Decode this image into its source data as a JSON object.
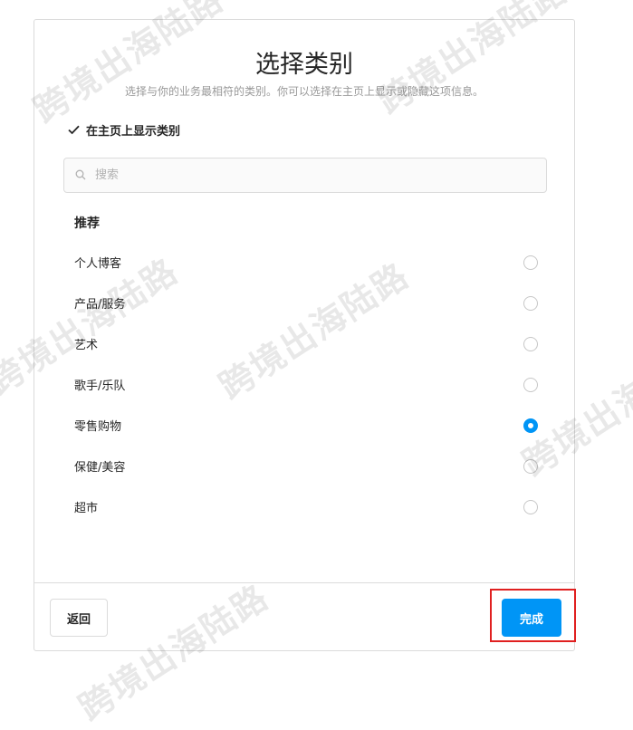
{
  "dialog": {
    "title": "选择类别",
    "subtitle": "选择与你的业务最相符的类别。你可以选择在主页上显示或隐藏这项信息。",
    "show_on_profile": {
      "label": "在主页上显示类别",
      "checked": true
    },
    "search": {
      "placeholder": "搜索",
      "value": ""
    },
    "section_title": "推荐",
    "categories": [
      {
        "label": "个人博客",
        "selected": false
      },
      {
        "label": "产品/服务",
        "selected": false
      },
      {
        "label": "艺术",
        "selected": false
      },
      {
        "label": "歌手/乐队",
        "selected": false
      },
      {
        "label": "零售购物",
        "selected": true
      },
      {
        "label": "保健/美容",
        "selected": false
      },
      {
        "label": "超市",
        "selected": false
      }
    ],
    "back_label": "返回",
    "done_label": "完成"
  },
  "watermark": {
    "text": "跨境出海陆路"
  },
  "colors": {
    "accent": "#0095f6",
    "highlight": "#e02020",
    "border": "#dbdbdb"
  },
  "icons": {
    "checkbox": "checkmark-icon",
    "search": "search-icon"
  }
}
